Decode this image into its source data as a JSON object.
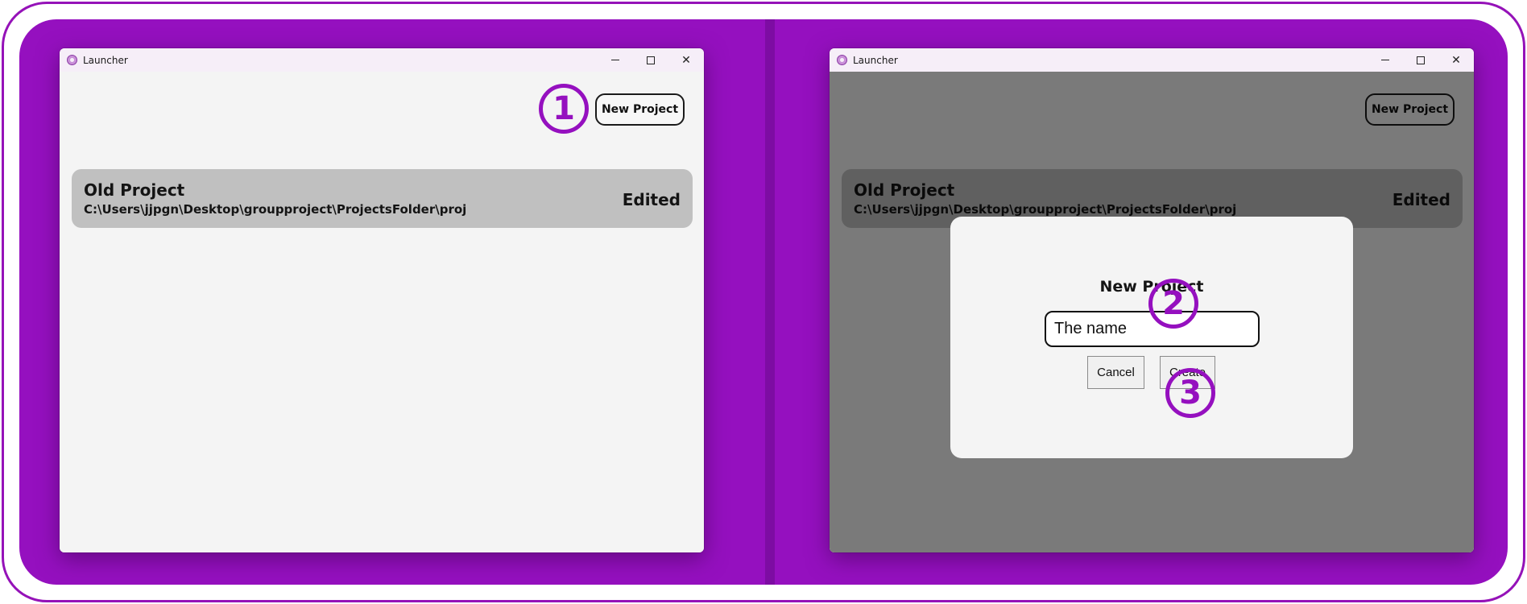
{
  "left_window": {
    "title": "Launcher",
    "new_project_label": "New Project",
    "project": {
      "name": "Old Project",
      "path": "C:\\Users\\jjpgn\\Desktop\\groupproject\\ProjectsFolder\\proj",
      "status": "Edited"
    }
  },
  "right_window": {
    "title": "Launcher",
    "new_project_label": "New Project",
    "project": {
      "name": "Old Project",
      "path": "C:\\Users\\jjpgn\\Desktop\\groupproject\\ProjectsFolder\\proj",
      "status": "Edited"
    },
    "dialog": {
      "title": "New Project",
      "input_value": "The name",
      "cancel_label": "Cancel",
      "create_label": "Create"
    }
  },
  "step_markers": [
    "1",
    "2",
    "3"
  ],
  "colors": {
    "accent": "#9510bf",
    "card": "#c0c0c0",
    "window_bg": "#f4f4f4",
    "titlebar": "#f6eef8"
  },
  "icons": {
    "app": "launcher-app-icon",
    "minimize": "minimize-icon",
    "maximize": "maximize-icon",
    "close": "close-icon"
  }
}
